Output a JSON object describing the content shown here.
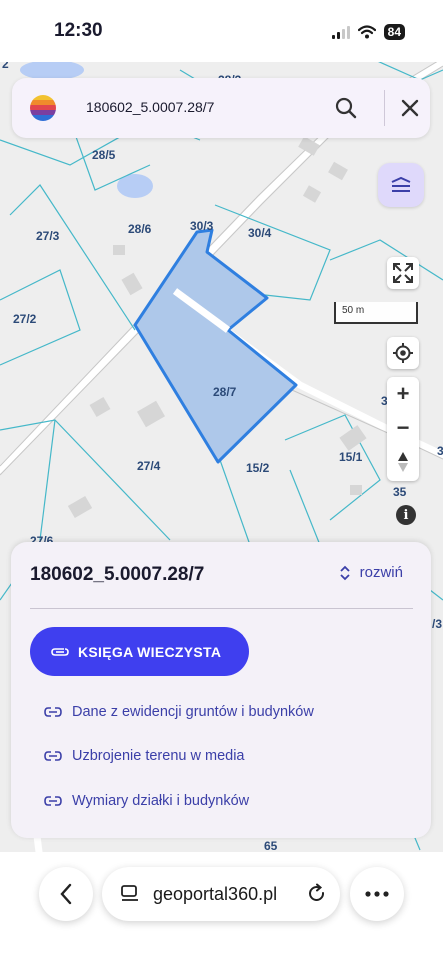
{
  "status_bar": {
    "time": "12:30",
    "battery": "84"
  },
  "search": {
    "query": "180602_5.0007.28/7"
  },
  "map": {
    "parcel_labels": [
      "28/3",
      "28/5",
      "27/3",
      "28/6",
      "30/3",
      "30/4",
      "27/2",
      "28/7",
      "27/4",
      "15/2",
      "15/1",
      "27/6",
      "35",
      "65",
      "3",
      "3",
      "/3",
      "2"
    ],
    "scale_label": "50 m",
    "highlight_color": "#2f7fe0",
    "highlight_fill": "#aec8ea"
  },
  "parcel_sheet": {
    "title": "180602_5.0007.28/7",
    "expand_label": "rozwiń",
    "primary_button": "KSIĘGA WIECZYSTA",
    "links": [
      "Dane z ewidencji gruntów i budynków",
      "Uzbrojenie terenu w media",
      "Wymiary działki i budynków"
    ]
  },
  "browser": {
    "domain": "geoportal360.pl"
  },
  "colors": {
    "accent": "#3f3fef",
    "link": "#3b3fa8",
    "sheet_bg": "#f4f1f8"
  }
}
